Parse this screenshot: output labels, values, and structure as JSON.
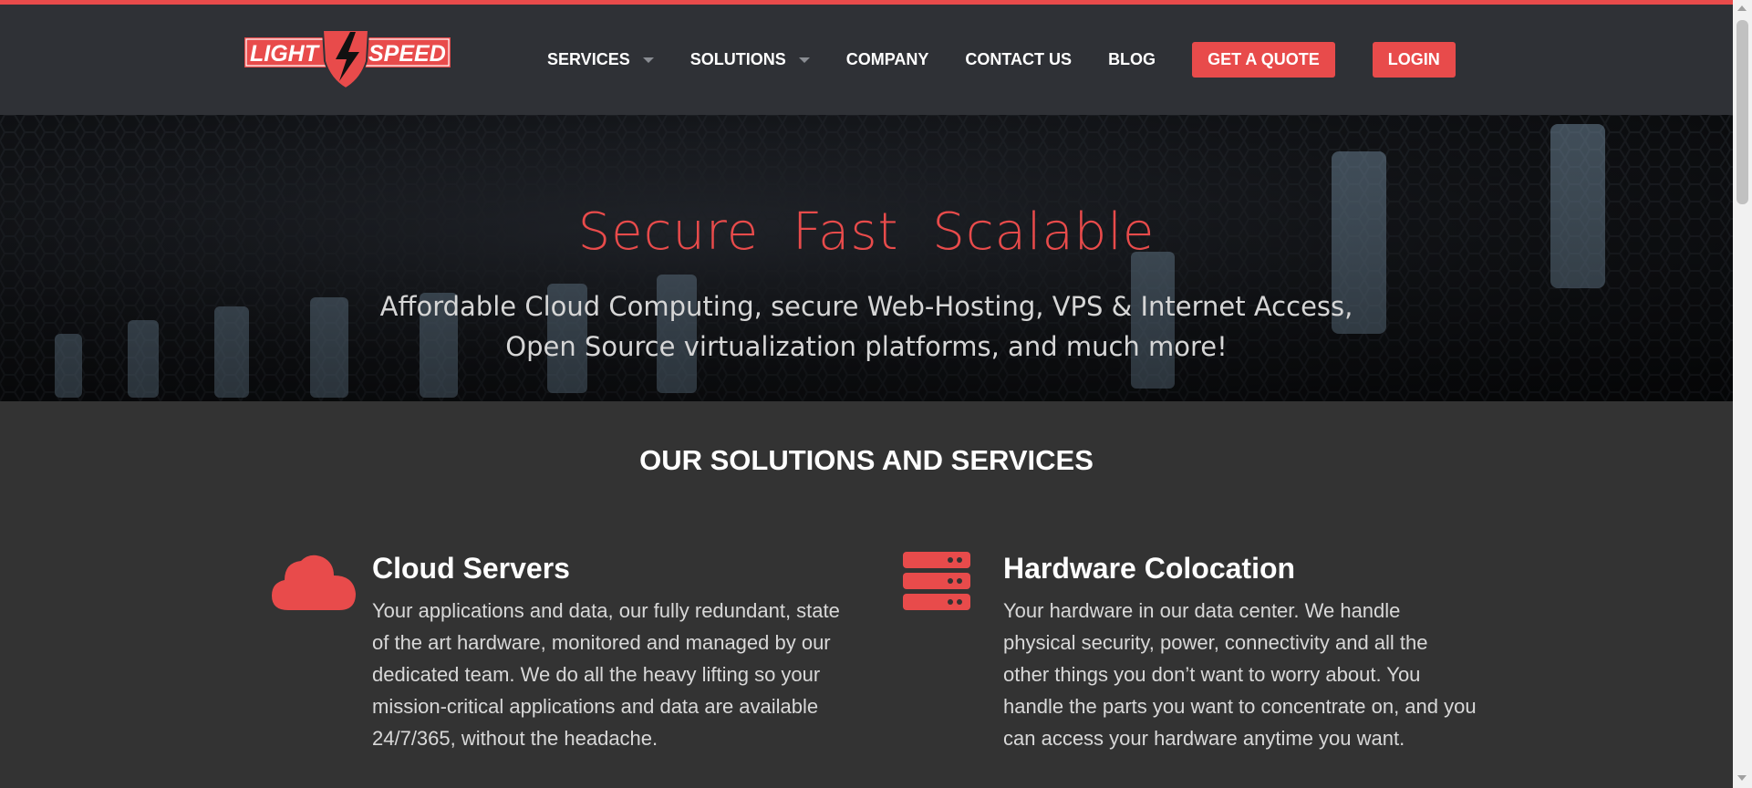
{
  "brand": {
    "logo_left": "LIGHT",
    "logo_right": "SPEED",
    "accent": "#e84b4b",
    "header_bg": "#2f3136"
  },
  "nav": {
    "items": [
      {
        "label": "SERVICES",
        "dropdown": true
      },
      {
        "label": "SOLUTIONS",
        "dropdown": true
      },
      {
        "label": "COMPANY",
        "dropdown": false
      },
      {
        "label": "CONTACT US",
        "dropdown": false
      },
      {
        "label": "BLOG",
        "dropdown": false
      }
    ],
    "quote_label": "GET A QUOTE",
    "login_label": "LOGIN"
  },
  "hero": {
    "title": "Secure Fast Scalable",
    "subtitle_line1": "Affordable Cloud Computing, secure Web-Hosting, VPS & Internet Access,",
    "subtitle_line2": "Open Source virtualization platforms, and much more!"
  },
  "solutions": {
    "title": "OUR SOLUTIONS AND SERVICES",
    "cards": [
      {
        "icon": "cloud-icon",
        "title": "Cloud Servers",
        "text": "Your applications and data, our fully redundant, state of the art hardware, monitored and managed by our dedicated team. We do all the heavy lifting so your mission-critical applications and data are available 24/7/365, without the headache."
      },
      {
        "icon": "server-rack-icon",
        "title": "Hardware Colocation",
        "text": "Your hardware in our data center. We handle physical security, power, connectivity and all the other things you don’t want to worry about. You handle the parts you want to concentrate on, and you can access your hardware anytime you want."
      }
    ]
  }
}
